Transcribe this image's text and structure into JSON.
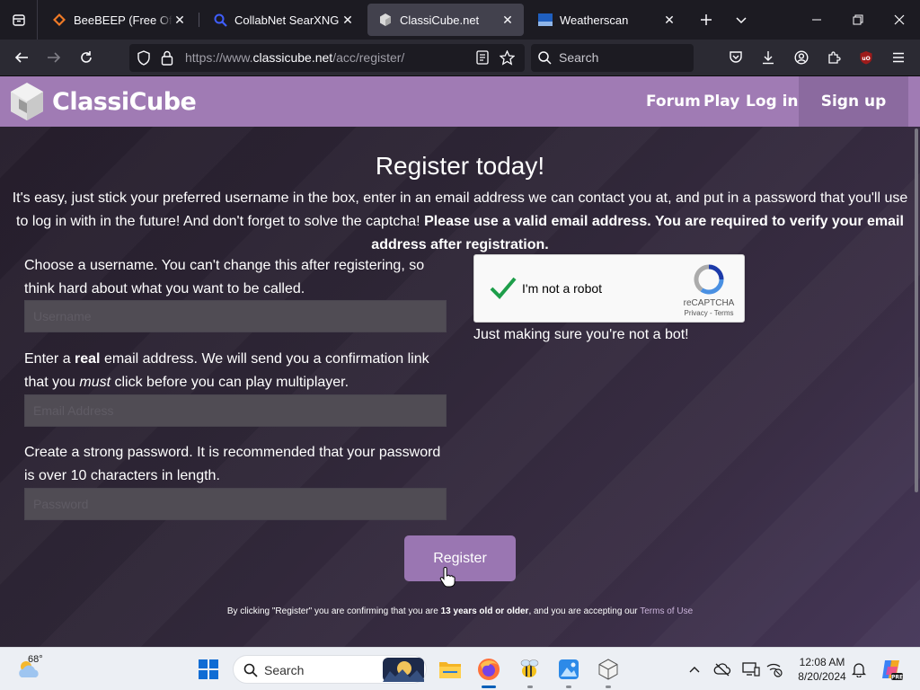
{
  "browser": {
    "tabs": [
      {
        "title": "BeeBEEP (Free Office M",
        "icon": "beebeep-favicon",
        "active": false
      },
      {
        "title": "CollabNet SearXNG",
        "icon": "searxng-favicon",
        "active": false
      },
      {
        "title": "ClassiCube.net",
        "icon": "classicube-favicon",
        "active": true
      },
      {
        "title": "Weatherscan",
        "icon": "weatherscan-favicon",
        "active": false
      }
    ],
    "url_prefix": "https://www.",
    "url_domain": "classicube.net",
    "url_path": "/acc/register/",
    "search_placeholder": "Search"
  },
  "site": {
    "logo_text": "ClassiCube",
    "nav": {
      "forum": "Forum",
      "play": "Play",
      "login": "Log in",
      "signup": "Sign up"
    },
    "header_color": "#a07bb4"
  },
  "register": {
    "heading": "Register today!",
    "intro_plain": "It's easy, just stick your preferred username in the box, enter in an email address we can contact you at, and put in a password that you'll use to log in with in the future! And don't forget to solve the captcha!",
    "intro_bold": "Please use a valid email address. You are required to verify your email address after registration.",
    "username_label": "Choose a username. You can't change this after registering, so think hard about what you want to be called.",
    "username_placeholder": "Username",
    "email_label_1": "Enter a ",
    "email_label_bold": "real",
    "email_label_2": " email address. We will send you a confirmation link that you ",
    "email_label_italic": "must",
    "email_label_3": " click before you can play multiplayer.",
    "email_placeholder": "Email Address",
    "password_label": "Create a strong password. It is recommended that your password is over 10 characters in length.",
    "password_placeholder": "Password",
    "captcha_text": "I'm not a robot",
    "captcha_brand": "reCAPTCHA",
    "captcha_links": "Privacy - Terms",
    "captcha_note": "Just making sure you're not a bot!",
    "button": "Register",
    "legal_1": "By clicking \"Register\" you are confirming that you are ",
    "legal_bold": "13 years old or older",
    "legal_2": ", and you are accepting our ",
    "legal_link": "Terms of Use"
  },
  "taskbar": {
    "weather_temp": "68°",
    "search_placeholder": "Search",
    "clock_time": "12:08 AM",
    "clock_date": "8/20/2024",
    "apps": [
      "windows-start-icon",
      "file-explorer-icon",
      "firefox-icon",
      "bee-app-icon",
      "photos-icon",
      "cube-app-icon"
    ]
  }
}
